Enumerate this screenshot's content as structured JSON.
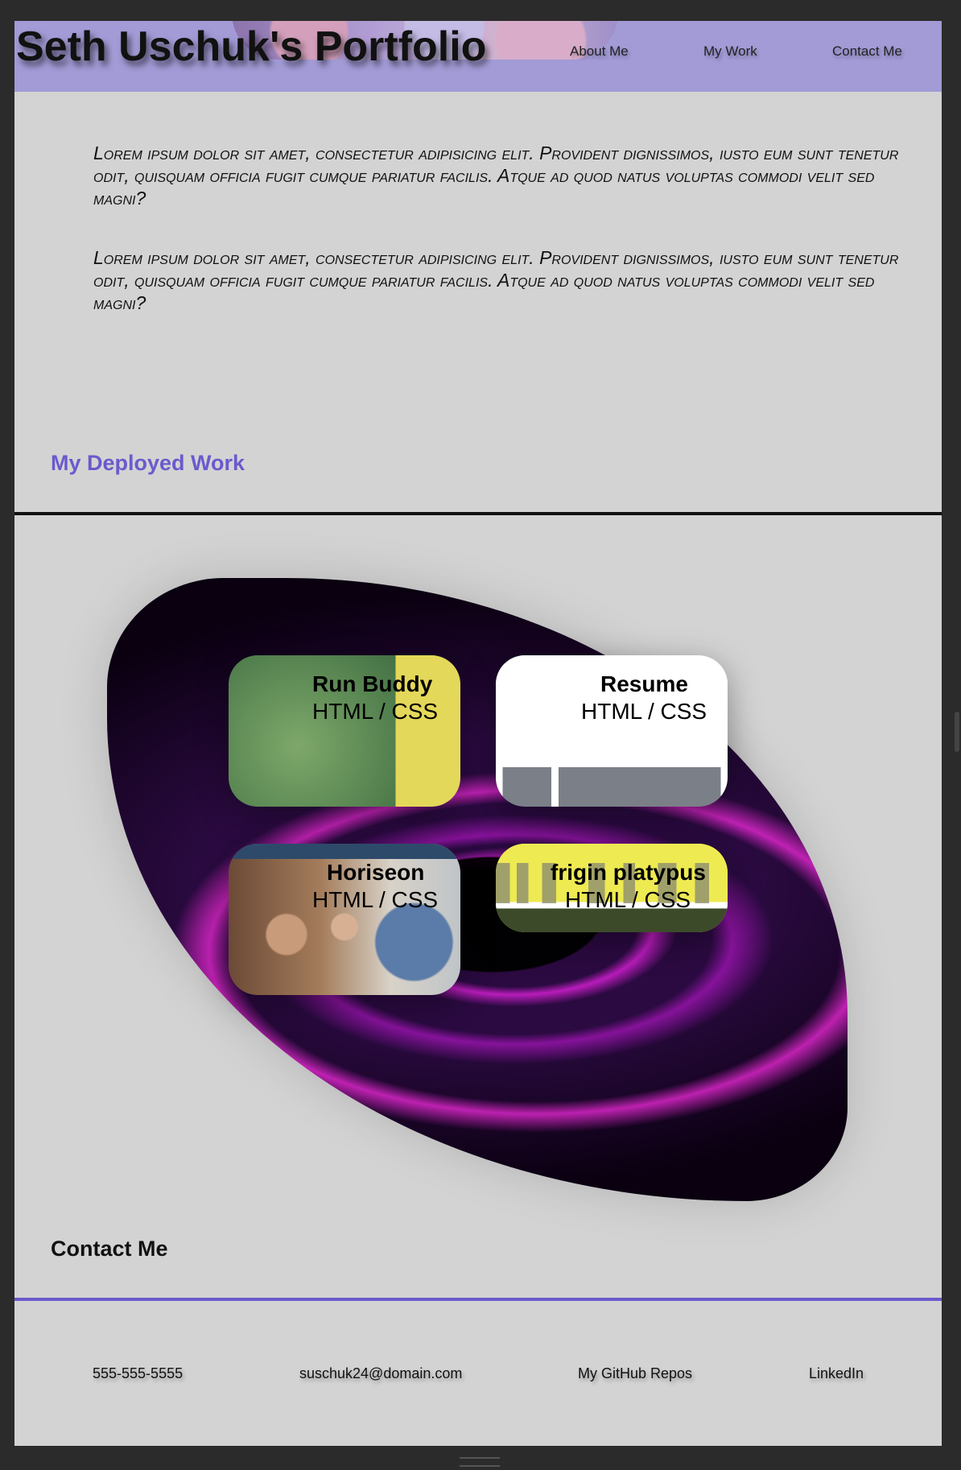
{
  "header": {
    "title": "Seth Uschuk's Portfolio",
    "nav": [
      "About Me",
      "My Work",
      "Contact Me"
    ]
  },
  "about": {
    "paragraphs": [
      "Lorem ipsum dolor sit amet, consectetur adipisicing elit. Provident dignissimos, iusto eum sunt tenetur odit, quisquam officia fugit cumque pariatur facilis. Atque ad quod natus voluptas commodi velit sed magni?",
      "Lorem ipsum dolor sit amet, consectetur adipisicing elit. Provident dignissimos, iusto eum sunt tenetur odit, quisquam officia fugit cumque pariatur facilis. Atque ad quod natus voluptas commodi velit sed magni?"
    ]
  },
  "work": {
    "heading": "My Deployed Work",
    "projects": [
      {
        "title": "Run Buddy",
        "tech": "HTML / CSS"
      },
      {
        "title": "Resume",
        "tech": "HTML / CSS"
      },
      {
        "title": "Horiseon",
        "tech": "HTML / CSS"
      },
      {
        "title": "frigin platypus",
        "tech": "HTML / CSS"
      }
    ]
  },
  "contact": {
    "heading": "Contact Me",
    "items": [
      "555-555-5555",
      "suschuk24@domain.com",
      "My GitHub Repos",
      "LinkedIn"
    ]
  },
  "colors": {
    "header_bg": "#a29bd6",
    "accent": "#6a5acd",
    "page_bg": "#d3d3d3",
    "frame_bg": "#2b2b2b"
  }
}
